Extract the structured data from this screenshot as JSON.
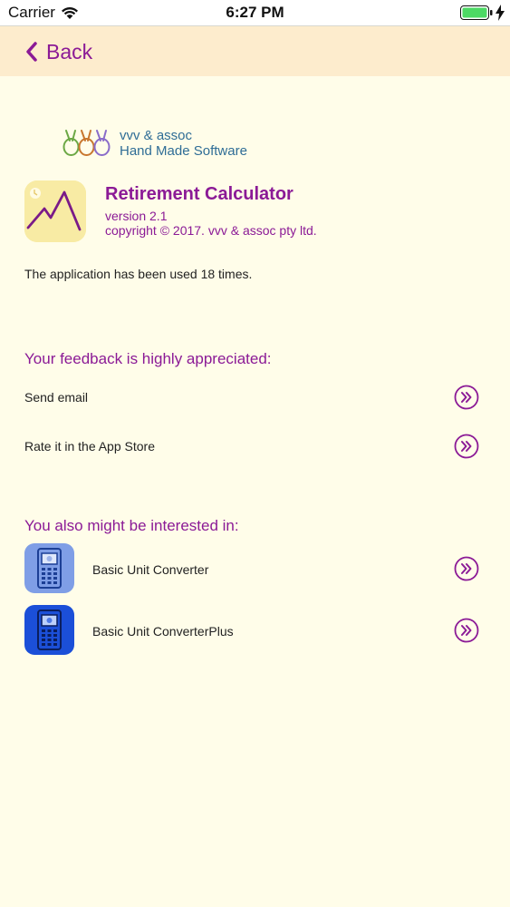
{
  "status_bar": {
    "carrier": "Carrier",
    "time": "6:27 PM"
  },
  "nav": {
    "back_label": "Back"
  },
  "company": {
    "line1": "vvv & assoc",
    "line2": "Hand Made Software"
  },
  "app": {
    "title": "Retirement Calculator",
    "version": "version 2.1",
    "copyright": "copyright © 2017. vvv & assoc pty ltd."
  },
  "usage": "The application has been used 18 times.",
  "feedback": {
    "heading": "Your feedback is highly appreciated:",
    "items": [
      {
        "label": "Send email"
      },
      {
        "label": "Rate it in the App Store"
      }
    ]
  },
  "related": {
    "heading": "You also might be interested in:",
    "items": [
      {
        "label": "Basic Unit Converter",
        "icon": "light-calculator-app-icon"
      },
      {
        "label": "Basic Unit ConverterPlus",
        "icon": "blue-calculator-app-icon"
      }
    ]
  },
  "colors": {
    "accent": "#8b1a96",
    "background": "#fffde9",
    "nav_background": "#fdeccd",
    "company_text": "#2f6d96",
    "battery": "#4cd964"
  }
}
